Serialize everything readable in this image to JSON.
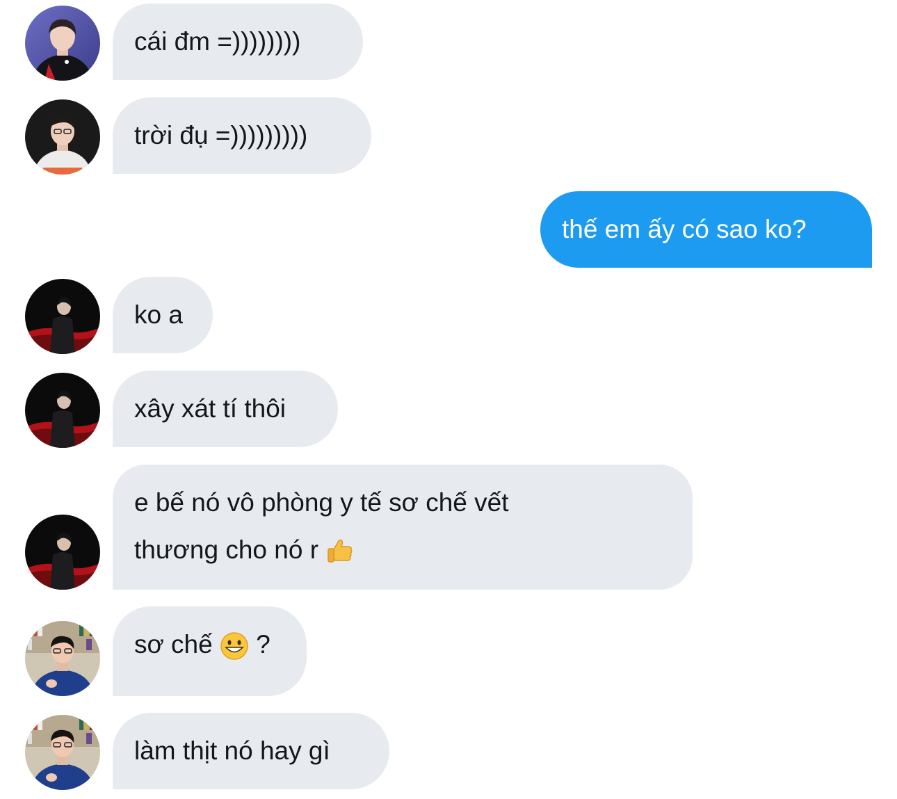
{
  "conversation": {
    "messages": [
      {
        "id": 1,
        "direction": "in",
        "sender_avatar": "avatar-red-jersey",
        "text": "cái đm =))))))))"
      },
      {
        "id": 2,
        "direction": "in",
        "sender_avatar": "avatar-hle-jersey",
        "text": "trời đụ =)))))))))"
      },
      {
        "id": 3,
        "direction": "out",
        "text": "thế em ấy có sao ko?"
      },
      {
        "id": 4,
        "direction": "in",
        "sender_avatar": "avatar-dark-stage",
        "text": "ko a"
      },
      {
        "id": 5,
        "direction": "in",
        "sender_avatar": "avatar-dark-stage",
        "text": "xây xát tí thôi"
      },
      {
        "id": 6,
        "direction": "in",
        "sender_avatar": "avatar-dark-stage",
        "line1": "e bế nó vô phòng y tế sơ chế vết",
        "line2": "thương cho nó r",
        "emoji": "thumbs-up-emoji"
      },
      {
        "id": 7,
        "direction": "in",
        "sender_avatar": "avatar-bookshelf",
        "text_before": "sơ chế",
        "emoji": "grinning-face-emoji",
        "text_after": "?"
      },
      {
        "id": 8,
        "direction": "in",
        "sender_avatar": "avatar-bookshelf",
        "text": "làm thịt nó hay gì"
      }
    ]
  },
  "colors": {
    "incoming_bubble": "#e7ebef",
    "outgoing_bubble": "#1d9bf0",
    "incoming_text": "#14171a",
    "outgoing_text": "#ffffff"
  }
}
